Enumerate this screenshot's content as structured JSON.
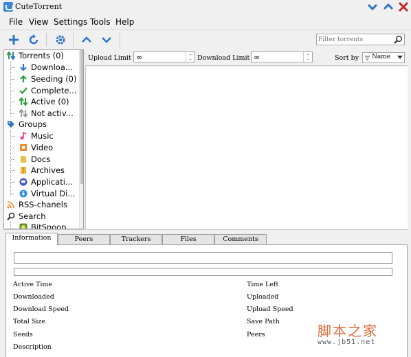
{
  "window": {
    "title": "CuteTorrent"
  },
  "menu": [
    "File",
    "View",
    "Settings",
    "Tools",
    "Help"
  ],
  "filter": {
    "placeholder": "Filter torrents"
  },
  "tree": {
    "torrents": "Torrents (0)",
    "downloading": "Downloa...",
    "seeding": "Seeding (0)",
    "completed": "Complete...",
    "active": "Active (0)",
    "not_active": "Not activ...",
    "groups": "Groups",
    "music": "Music",
    "video": "Video",
    "docs": "Docs",
    "archives": "Archives",
    "applications": "Applicati...",
    "virtual_disks": "Virtual Di...",
    "rss": "RSS-chanels",
    "search": "Search",
    "bitsnoop": "BitSnoop"
  },
  "limits": {
    "upload_label": "Upload Limit",
    "upload_value": "∞",
    "download_label": "Download Limit",
    "download_value": "∞",
    "sort_label": "Sort by",
    "sort_value": "Name"
  },
  "tabs": [
    "Information",
    "Peers",
    "Trackers",
    "Files",
    "Comments"
  ],
  "info": {
    "left": [
      "Active Time",
      "Downloaded",
      "Download Speed",
      "Total Size",
      "Seeds",
      "Description"
    ],
    "right": [
      "Time Left",
      "Uploaded",
      "Upload Speed",
      "Save Path",
      "Peers"
    ]
  },
  "watermark": {
    "cn": "脚本之家",
    "url": "www.jb51.net"
  }
}
